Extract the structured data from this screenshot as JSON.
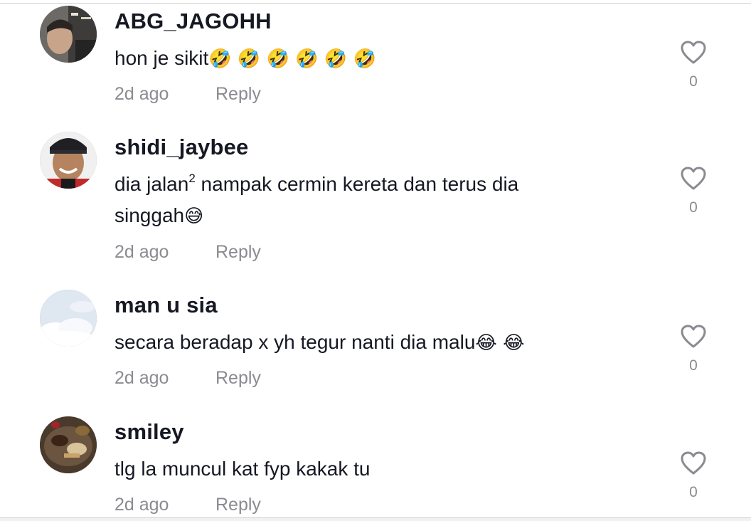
{
  "comments": [
    {
      "username": "ABG_JAGOHH",
      "text": "hon je sikit",
      "emojis": "🤣 🤣 🤣 🤣 🤣 🤣",
      "time": "2d ago",
      "reply_label": "Reply",
      "likes": "0",
      "avatar_icon": "avatar-photo-man-indoor"
    },
    {
      "username": "shidi_jaybee",
      "text_line1_pre": "dia jalan",
      "text_line1_sup": "2",
      "text_line1_post": " nampak cermin kereta dan terus dia",
      "text_line2": "singgah",
      "emojis": "😅",
      "time": "2d ago",
      "reply_label": "Reply",
      "likes": "0",
      "avatar_icon": "avatar-photo-smiling-man-cap"
    },
    {
      "username": "man u sia",
      "text": "secara beradap x yh tegur nanti dia malu",
      "emojis": "😂 😂",
      "time": "2d ago",
      "reply_label": "Reply",
      "likes": "0",
      "avatar_icon": "avatar-photo-sky-clouds"
    },
    {
      "username": "smiley",
      "text": "tlg la muncul kat fyp kakak tu",
      "time": "2d ago",
      "reply_label": "Reply",
      "likes": "0",
      "avatar_icon": "avatar-photo-food-plate"
    }
  ],
  "colors": {
    "username": "#161823",
    "secondary": "#8a8b91",
    "heart_stroke": "#8a8b91"
  }
}
